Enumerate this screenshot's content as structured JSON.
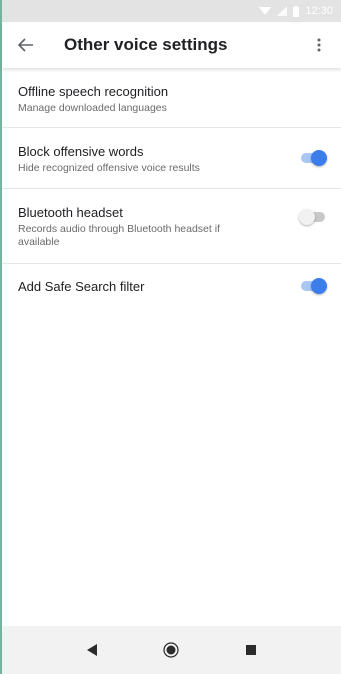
{
  "status": {
    "time": "12:30"
  },
  "appbar": {
    "title": "Other voice settings"
  },
  "settings": [
    {
      "title": "Offline speech recognition",
      "subtitle": "Manage downloaded languages"
    },
    {
      "title": "Block offensive words",
      "subtitle": "Hide recognized offensive voice results",
      "enabled": true
    },
    {
      "title": "Bluetooth headset",
      "subtitle": "Records audio through Bluetooth headset if available",
      "enabled": false
    },
    {
      "title": "Add Safe Search filter",
      "enabled": true
    }
  ],
  "icons": {
    "back": "arrow-back-icon",
    "more": "more-vert-icon",
    "nav": [
      "back-triangle-icon",
      "home-circle-icon",
      "recents-square-icon"
    ]
  },
  "colors": {
    "accent": "#3b7ded",
    "accent_track": "#a9c7f4"
  }
}
